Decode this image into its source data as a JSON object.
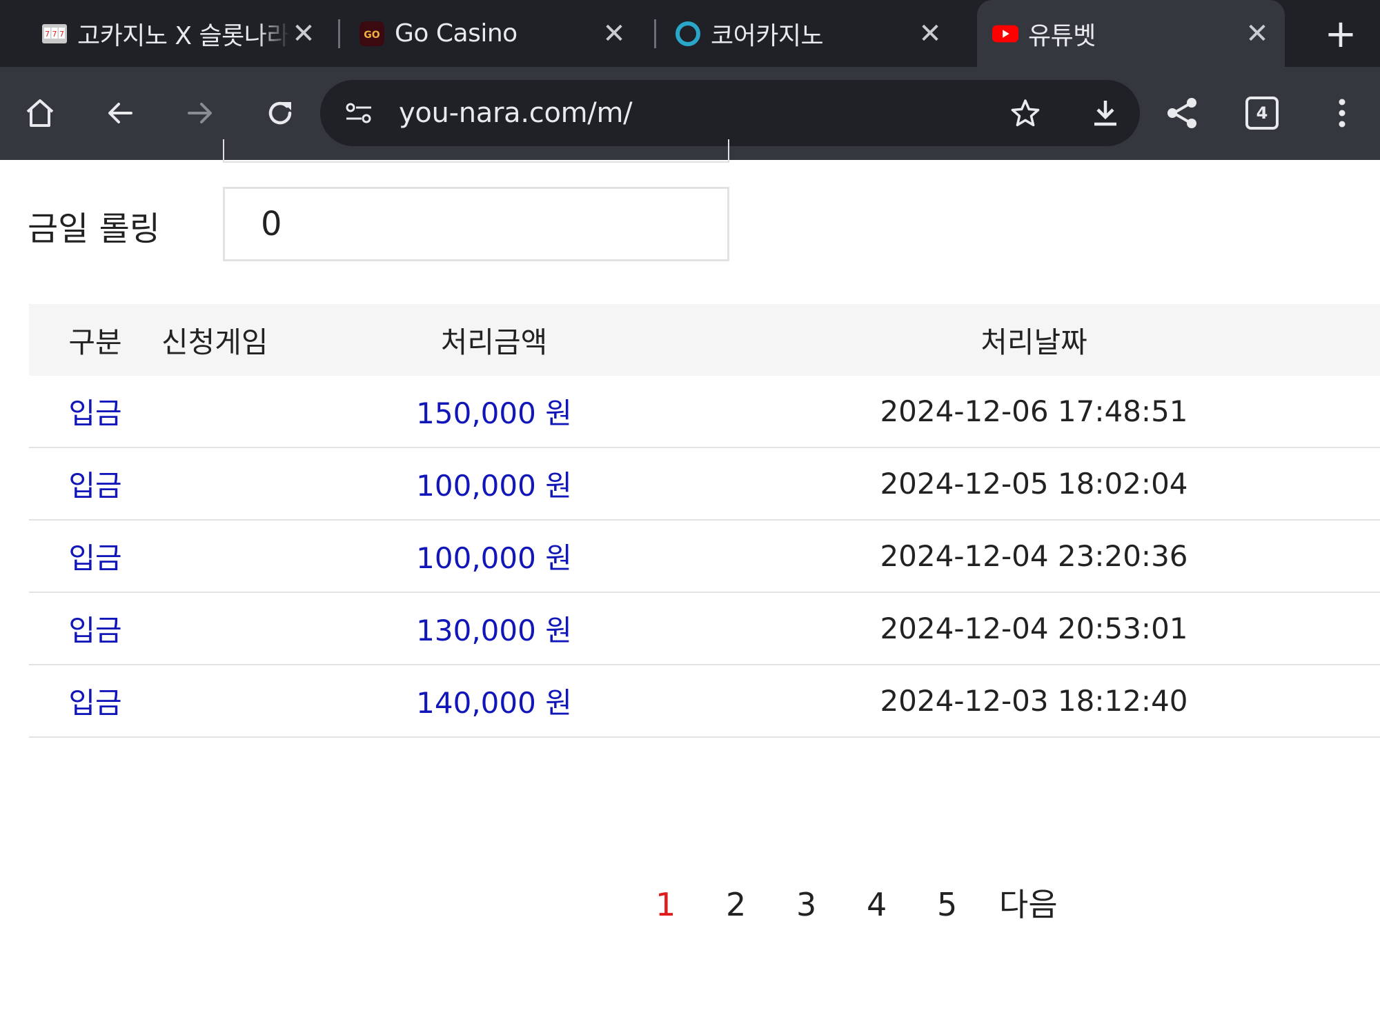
{
  "tabs": [
    {
      "title": "고카지노 X 슬롯나라",
      "favicon": "slot-machine-icon",
      "active": false
    },
    {
      "title": "Go Casino",
      "favicon": "go-casino-icon",
      "active": false
    },
    {
      "title": "코어카지노",
      "favicon": "ring-icon",
      "active": false
    },
    {
      "title": "유튜벳",
      "favicon": "youtube-icon",
      "active": true
    }
  ],
  "toolbar": {
    "url": "you-nara.com/m/",
    "tab_count": "4"
  },
  "rolling": {
    "label": "금일 롤링",
    "value": "0"
  },
  "table": {
    "headers": {
      "type": "구분",
      "game": "신청게임",
      "amount": "처리금액",
      "date": "처리날짜"
    },
    "rows": [
      {
        "type": "입금",
        "game": "",
        "amount": "150,000 원",
        "date": "2024-12-06 17:48:51"
      },
      {
        "type": "입금",
        "game": "",
        "amount": "100,000 원",
        "date": "2024-12-05 18:02:04"
      },
      {
        "type": "입금",
        "game": "",
        "amount": "100,000 원",
        "date": "2024-12-04 23:20:36"
      },
      {
        "type": "입금",
        "game": "",
        "amount": "130,000 원",
        "date": "2024-12-04 20:53:01"
      },
      {
        "type": "입금",
        "game": "",
        "amount": "140,000 원",
        "date": "2024-12-03 18:12:40"
      }
    ]
  },
  "pagination": {
    "pages": [
      "1",
      "2",
      "3",
      "4",
      "5"
    ],
    "current": "1",
    "next_label": "다음"
  },
  "colors": {
    "link_blue": "#1016b8",
    "current_page_red": "#e01b1b",
    "chrome_dark": "#1f2126",
    "chrome_toolbar": "#34373d"
  }
}
